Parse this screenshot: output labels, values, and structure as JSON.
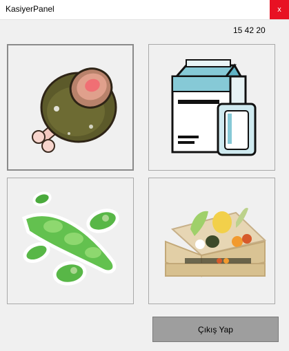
{
  "window": {
    "title": "KasiyerPanel",
    "close_label": "x"
  },
  "clock": "15 42 20",
  "tiles": [
    {
      "icon": "meat-icon"
    },
    {
      "icon": "milk-icon"
    },
    {
      "icon": "beans-icon"
    },
    {
      "icon": "vegetable-crate-icon"
    }
  ],
  "exit_button": {
    "label": "Çıkış Yap"
  }
}
